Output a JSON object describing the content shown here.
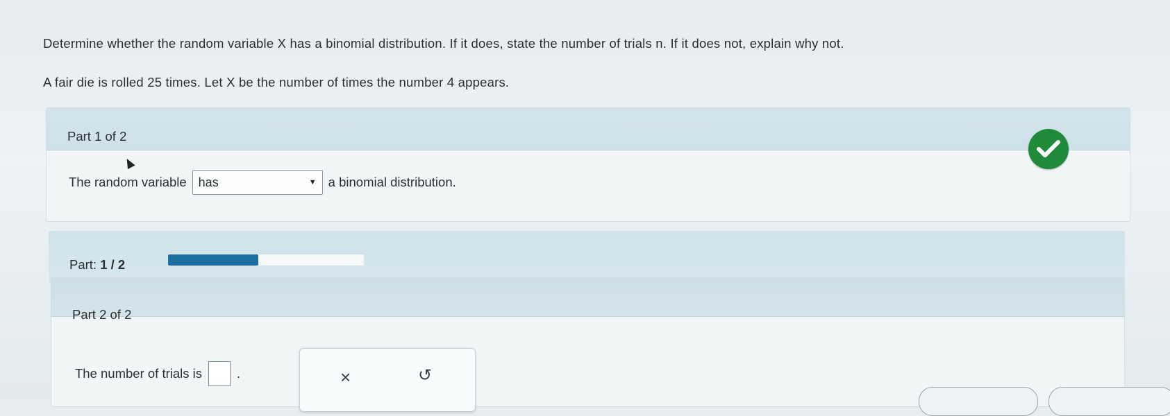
{
  "question": {
    "prompt": "Determine whether the random variable X has a binomial distribution. If it does, state the number of trials n. If it does not, explain why not.",
    "scenario": "A fair die is rolled 25 times. Let X be the number of times the number 4 appears."
  },
  "part1": {
    "title": "Part 1 of 2",
    "sentence_before": "The random variable",
    "dropdown_value": "has",
    "sentence_after": "a binomial distribution.",
    "status": "correct"
  },
  "progress": {
    "label": "Part:",
    "value": "1 / 2",
    "fraction": 0.46
  },
  "part2": {
    "title": "Part 2 of 2",
    "sentence_before": "The number of trials is",
    "sentence_after": ".",
    "answer_value": "",
    "tools": {
      "clear": "×",
      "undo": "↺"
    }
  },
  "colors": {
    "accent": "#1c6fa0",
    "success": "#1f8a3a"
  }
}
